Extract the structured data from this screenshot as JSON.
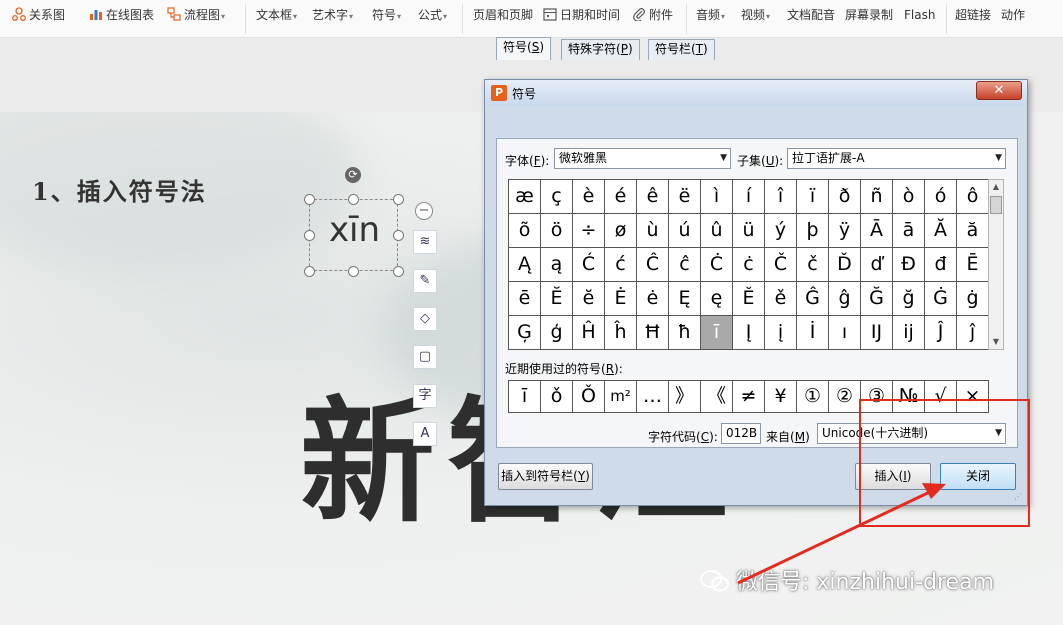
{
  "ribbon": {
    "items": [
      {
        "label": "关系图",
        "icon": "relation-icon",
        "dropdown": false
      },
      {
        "label": "在线图表",
        "icon": "chart-icon",
        "dropdown": false
      },
      {
        "label": "流程图",
        "icon": "flowchart-icon",
        "dropdown": true
      },
      {
        "label": "文本框",
        "icon": "",
        "dropdown": true
      },
      {
        "label": "艺术字",
        "icon": "",
        "dropdown": true
      },
      {
        "label": "符号",
        "icon": "",
        "dropdown": true
      },
      {
        "label": "公式",
        "icon": "",
        "dropdown": true
      },
      {
        "label": "页眉和页脚",
        "icon": "",
        "dropdown": false
      },
      {
        "label": "日期和时间",
        "icon": "calendar-icon",
        "dropdown": false
      },
      {
        "label": "附件",
        "icon": "attachment-icon",
        "dropdown": false
      },
      {
        "label": "音频",
        "icon": "",
        "dropdown": true
      },
      {
        "label": "视频",
        "icon": "",
        "dropdown": true
      },
      {
        "label": "文档配音",
        "icon": "",
        "dropdown": false
      },
      {
        "label": "屏幕录制",
        "icon": "",
        "dropdown": false
      },
      {
        "label": "Flash",
        "icon": "",
        "dropdown": false
      },
      {
        "label": "超链接",
        "icon": "",
        "dropdown": false
      },
      {
        "label": "动作",
        "icon": "",
        "dropdown": false
      }
    ]
  },
  "slide": {
    "title": "1、插入符号法",
    "textbox_text": "xīn",
    "big_text": "新智汇",
    "watermark": "微信号: xinzhihui-dream"
  },
  "dialog": {
    "title": "符号",
    "tabs": [
      {
        "label": "符号",
        "key": "S",
        "active": true
      },
      {
        "label": "特殊字符",
        "key": "P",
        "active": false
      },
      {
        "label": "符号栏",
        "key": "T",
        "active": false
      }
    ],
    "font_label": "字体",
    "font_key": "F",
    "font_value": "微软雅黑",
    "subset_label": "子集",
    "subset_key": "U",
    "subset_value": "拉丁语扩展-A",
    "symbols": [
      "æ",
      "ç",
      "è",
      "é",
      "ê",
      "ë",
      "ì",
      "í",
      "î",
      "ï",
      "ð",
      "ñ",
      "ò",
      "ó",
      "ô",
      "õ",
      "ö",
      "÷",
      "ø",
      "ù",
      "ú",
      "û",
      "ü",
      "ý",
      "þ",
      "ÿ",
      "Ā",
      "ā",
      "Ă",
      "ă",
      "Ą",
      "ą",
      "Ć",
      "ć",
      "Ĉ",
      "ĉ",
      "Ċ",
      "ċ",
      "Č",
      "č",
      "Ď",
      "ď",
      "Đ",
      "đ",
      "Ē",
      "ē",
      "Ĕ",
      "ĕ",
      "Ė",
      "ė",
      "Ę",
      "ę",
      "Ě",
      "ě",
      "Ĝ",
      "ĝ",
      "Ğ",
      "ğ",
      "Ġ",
      "ġ",
      "Ģ",
      "ģ",
      "Ĥ",
      "ĥ",
      "Ħ",
      "ħ",
      "ī",
      "Į",
      "į",
      "İ",
      "ı",
      "Ĳ",
      "ĳ",
      "Ĵ",
      "ĵ"
    ],
    "selected_symbol": "ī",
    "recent_label": "近期使用过的符号",
    "recent_key": "R",
    "recent": [
      "ī",
      "ǒ",
      "Ǒ",
      "m²",
      "…",
      "》",
      "《",
      "≠",
      "¥",
      "①",
      "②",
      "③",
      "№",
      "√",
      "×"
    ],
    "code_label": "字符代码",
    "code_key": "C",
    "code_value": "012B",
    "from_label": "来自",
    "from_key": "M",
    "from_value": "Unicode(十六进制)",
    "insert_to_bar_label": "插入到符号栏",
    "insert_to_bar_key": "Y",
    "insert_label": "插入",
    "insert_key": "I",
    "close_label": "关闭"
  },
  "colors": {
    "annotation_red": "#e32a1e",
    "accent_orange": "#e8601c"
  }
}
